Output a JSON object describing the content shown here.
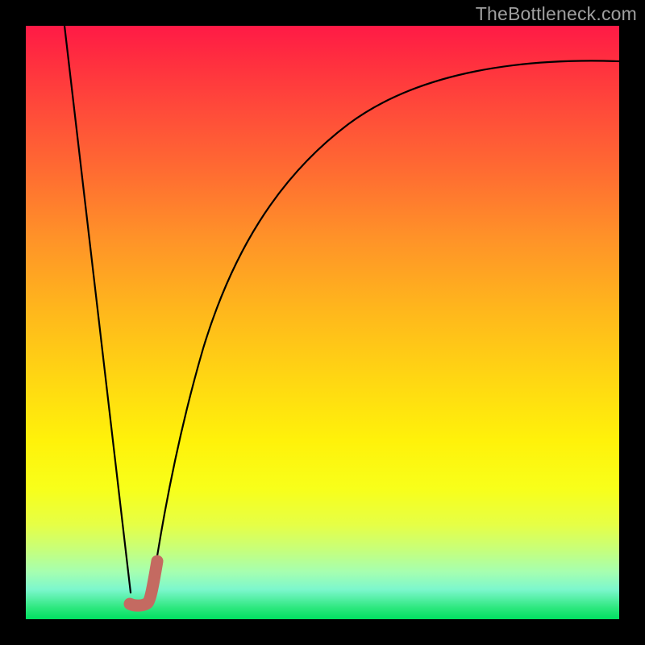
{
  "watermark": "TheBottleneck.com",
  "colors": {
    "frame": "#000000",
    "gradient_top": "#ff1a46",
    "gradient_bottom": "#00e060",
    "curve": "#000000",
    "accent": "#c46a61"
  },
  "chart_data": {
    "type": "line",
    "title": "",
    "xlabel": "",
    "ylabel": "",
    "xlim": [
      0,
      100
    ],
    "ylim": [
      0,
      100
    ],
    "grid": false,
    "legend": false,
    "note": "Values estimated by reading pixel positions; x and y are normalized 0–100 (y=0 bottom, y=100 top).",
    "series": [
      {
        "name": "left-falling-line",
        "style": "line",
        "color": "#000000",
        "x": [
          6.5,
          8,
          10,
          12,
          14,
          16,
          17.7
        ],
        "y": [
          100,
          87,
          70,
          53,
          36,
          19,
          4.5
        ]
      },
      {
        "name": "right-rising-curve",
        "style": "line",
        "color": "#000000",
        "x": [
          21,
          22,
          24,
          26,
          28,
          30,
          33,
          36,
          40,
          45,
          50,
          55,
          60,
          67,
          75,
          85,
          95,
          100
        ],
        "y": [
          3.5,
          9,
          21,
          32,
          42,
          50,
          58,
          65,
          71,
          76,
          80,
          83,
          85.5,
          88,
          90,
          92,
          93.5,
          94
        ]
      },
      {
        "name": "accent-hook",
        "style": "line",
        "color": "#c46a61",
        "stroke_width": 14,
        "x": [
          17.5,
          18.5,
          19.8,
          20.5,
          21,
          21.6,
          22.2
        ],
        "y": [
          2.5,
          2.3,
          2.3,
          2.6,
          3.8,
          6.6,
          10
        ]
      }
    ]
  }
}
